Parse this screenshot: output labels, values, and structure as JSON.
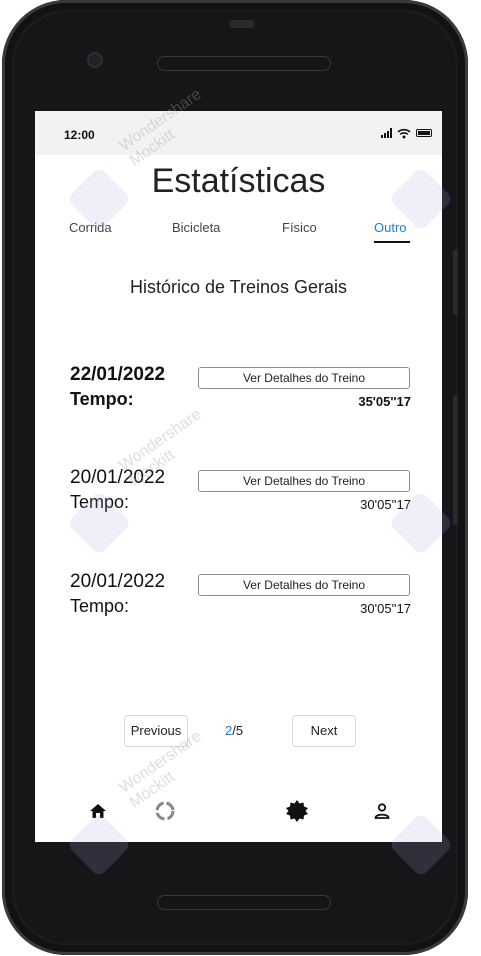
{
  "status_bar": {
    "time": "12:00"
  },
  "header": {
    "title": "Estatísticas"
  },
  "tabs": [
    {
      "label": "Corrida",
      "active": false
    },
    {
      "label": "Bicicleta",
      "active": false
    },
    {
      "label": "Físico",
      "active": false
    },
    {
      "label": "Outro",
      "active": true
    }
  ],
  "section": {
    "title": "Histórico de Treinos Gerais"
  },
  "entries": [
    {
      "date": "22/01/2022",
      "time_label": "Tempo:",
      "time_value": "35'05''17",
      "button_label": "Ver Detalhes do Treino",
      "emphasis": true
    },
    {
      "date": "20/01/2022",
      "time_label": "Tempo:",
      "time_value": "30'05''17",
      "button_label": "Ver Detalhes do Treino",
      "emphasis": false
    },
    {
      "date": "20/01/2022",
      "time_label": "Tempo:",
      "time_value": "30'05''17",
      "button_label": "Ver Detalhes do Treino",
      "emphasis": false
    }
  ],
  "pagination": {
    "previous_label": "Previous",
    "current_page": "2",
    "page_separator": "/5",
    "next_label": "Next"
  },
  "bottom_nav": [
    {
      "icon": "home-icon"
    },
    {
      "icon": "loading-ring-icon"
    },
    {
      "icon": "badge-icon"
    },
    {
      "icon": "user-icon"
    }
  ],
  "watermark": {
    "line1": "Wondershare",
    "line2": "Mockitt"
  },
  "colors": {
    "accent": "#1c7fd6",
    "status_bar_bg": "#f2f2f2",
    "phone_body": "#1c1c1e"
  }
}
